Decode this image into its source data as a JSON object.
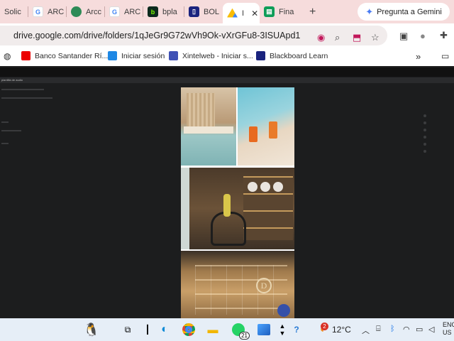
{
  "tabs": [
    {
      "label": "Solic",
      "icon": "generic-icon",
      "color": "#7a7a7a"
    },
    {
      "label": "ARC",
      "icon": "google-icon",
      "color": "#4285f4"
    },
    {
      "label": "Arcc",
      "icon": "globe-icon",
      "color": "#2e8b57"
    },
    {
      "label": "ARC",
      "icon": "google-icon",
      "color": "#4285f4"
    },
    {
      "label": "bpla",
      "icon": "b-icon",
      "color": "#0c2a1e"
    },
    {
      "label": "BOL",
      "icon": "bol-icon",
      "color": "#1a237e"
    },
    {
      "label": "I",
      "icon": "drive-icon",
      "color": "#fbbc04",
      "active": true
    },
    {
      "label": "Fina",
      "icon": "sheets-icon",
      "color": "#0f9d58"
    }
  ],
  "new_tab_label": "+",
  "gemini_label": "Pregunta a Gemini",
  "url": "drive.google.com/drive/folders/1qJeGr9G72wVh9Ok-vXrGFu8-3ISUApd1",
  "bookmarks": [
    {
      "label": "Banco Santander Rí...",
      "color": "#ec0000"
    },
    {
      "label": "Iniciar sesión",
      "color": "#1e88e5"
    },
    {
      "label": "Xintelweb - Iniciar s...",
      "color": "#3f51b5"
    },
    {
      "label": "Blackboard Learn",
      "color": "#1a237e"
    }
  ],
  "viewer_title": "plantilla de audio",
  "taskbar": {
    "notification_badge": "21",
    "weather_badge": "2",
    "temperature": "12°C",
    "lang_top": "ENG",
    "lang_bottom": "US"
  },
  "colors": {
    "tabstrip": "#f6dcdc",
    "viewer_bg": "#1c1d1e",
    "taskbar": "#e6eef7"
  }
}
